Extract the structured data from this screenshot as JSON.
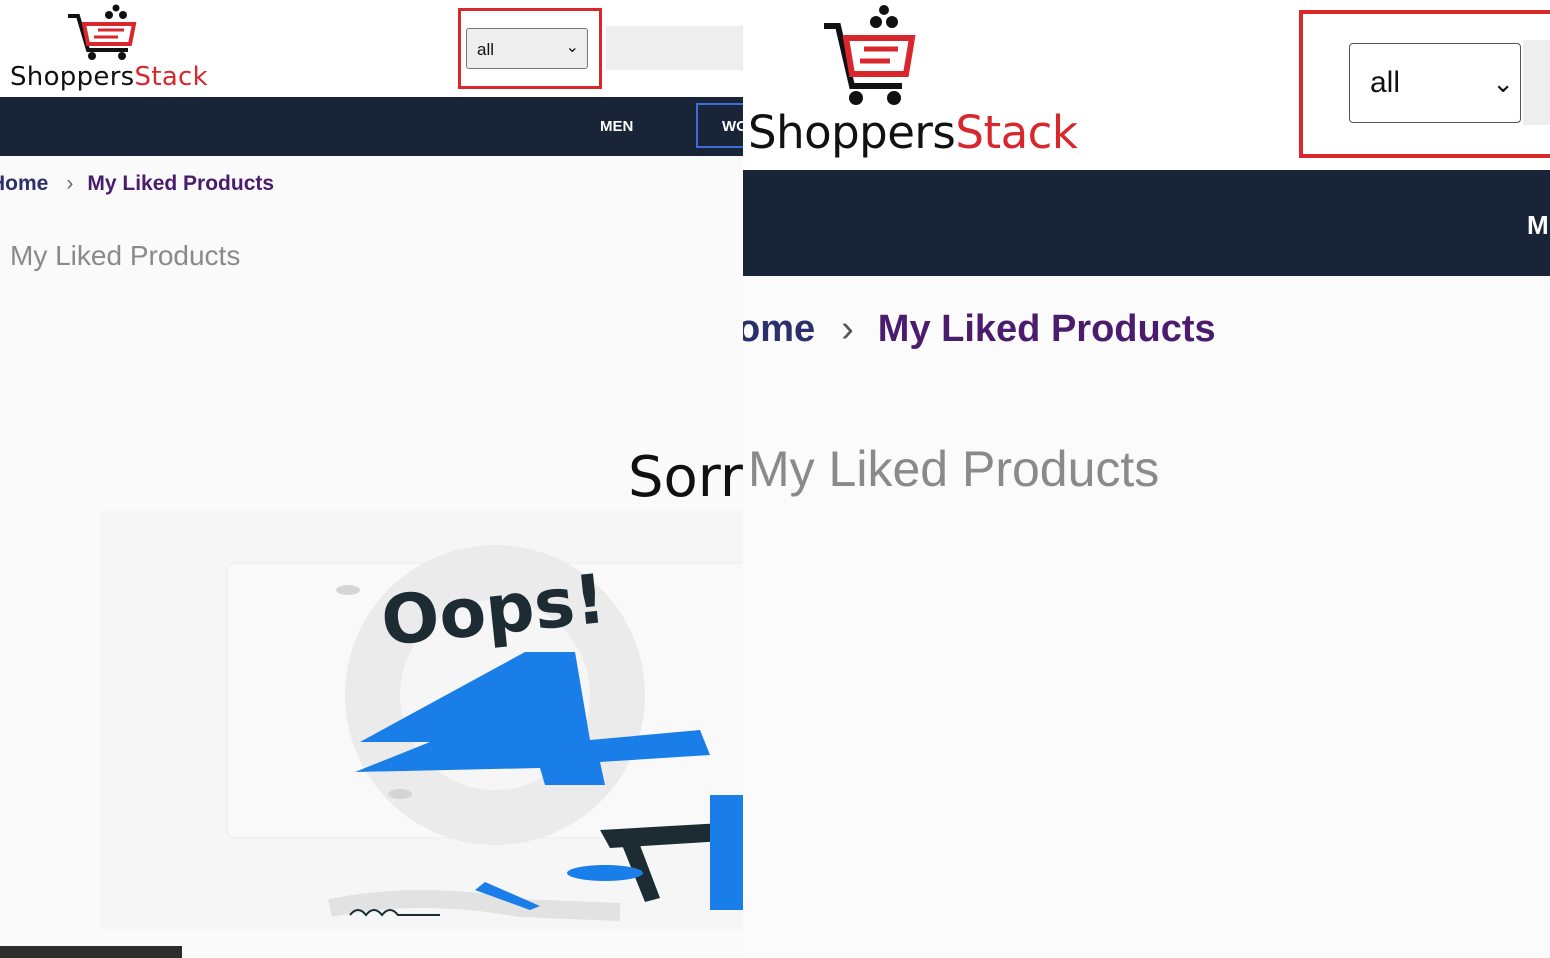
{
  "colors": {
    "brand_red": "#d8272d",
    "nav_bg": "#1a2438",
    "crumb_current": "#4b1b6e",
    "highlight": "#d8272d"
  },
  "left": {
    "brand_part1": "Shoppers",
    "brand_part2": "Stack",
    "category_select": {
      "value": "all",
      "icon": "chevron-down-icon"
    },
    "nav": {
      "men": "MEN",
      "women_partial": "WO"
    },
    "breadcrumb": {
      "home": "Home",
      "separator": "›",
      "current": "My Liked Products"
    },
    "page_title": "My Liked Products",
    "empty_message_partial": "Sorr",
    "illustration": {
      "text": "Oops!",
      "digit": "4"
    }
  },
  "right": {
    "brand_part1": "Shoppers",
    "brand_part2": "Stack",
    "category_select": {
      "value": "all",
      "icon": "chevron-down-icon"
    },
    "nav": {
      "men_partial": "M"
    },
    "breadcrumb": {
      "home_partial": "ome",
      "separator": "›",
      "current": "My Liked Products"
    },
    "page_title": "My Liked Products"
  }
}
